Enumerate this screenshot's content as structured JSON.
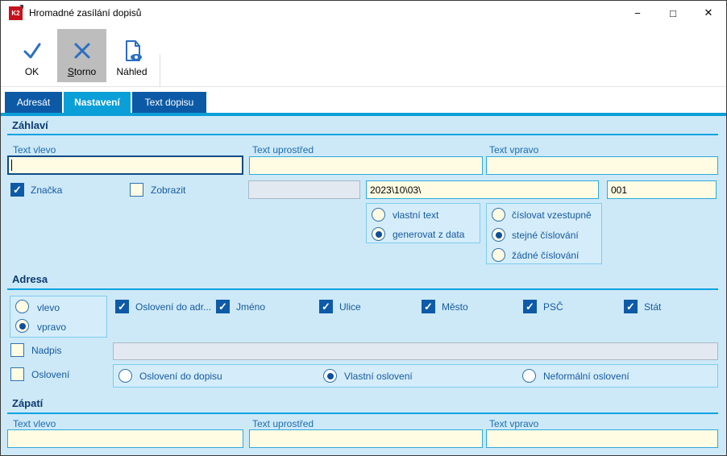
{
  "window": {
    "title": "Hromadné zasílání dopisů",
    "app_icon_text": "K2",
    "controls": {
      "minimize": "−",
      "maximize": "□",
      "close": "✕"
    }
  },
  "toolbar": {
    "buttons": [
      {
        "label": "OK",
        "icon": "ok-check-icon",
        "pressed": false
      },
      {
        "label": "Storno",
        "icon": "cancel-x-icon",
        "pressed": true
      },
      {
        "label": "Náhled",
        "icon": "preview-document-icon",
        "pressed": false
      }
    ]
  },
  "tabs": [
    {
      "label": "Adresát",
      "active": false
    },
    {
      "label": "Nastavení",
      "active": true
    },
    {
      "label": "Text dopisu",
      "active": false
    }
  ],
  "sections": {
    "zahlavi": {
      "title": "Záhlaví",
      "header_fields": [
        {
          "label": "Text vlevo",
          "value": "",
          "focused": true
        },
        {
          "label": "Text uprostřed",
          "value": "",
          "focused": false
        },
        {
          "label": "Text vpravo",
          "value": "",
          "focused": false
        }
      ],
      "znacka": {
        "label": "Značka",
        "checked": true
      },
      "zobrazit": {
        "label": "Zobrazit",
        "checked": false
      },
      "disabled_value": "",
      "date_value": "2023\\10\\03\\",
      "number_value": "001",
      "text_source_group": [
        {
          "label": "vlastní text",
          "selected": false
        },
        {
          "label": "generovat z data",
          "selected": true
        }
      ],
      "numbering_group": [
        {
          "label": "číslovat vzestupně",
          "selected": false
        },
        {
          "label": "stejné číslování",
          "selected": true
        },
        {
          "label": "žádné číslování",
          "selected": false
        }
      ]
    },
    "adresa": {
      "title": "Adresa",
      "position_group": [
        {
          "label": "vlevo",
          "selected": false
        },
        {
          "label": "vpravo",
          "selected": true
        }
      ],
      "checkboxes": [
        {
          "label": "Oslovení do adr...",
          "checked": true
        },
        {
          "label": "Jméno",
          "checked": true
        },
        {
          "label": "Ulice",
          "checked": true
        },
        {
          "label": "Město",
          "checked": true
        },
        {
          "label": "PSČ",
          "checked": true
        },
        {
          "label": "Stát",
          "checked": true
        }
      ],
      "nadpis": {
        "label": "Nadpis",
        "checked": false,
        "value": ""
      },
      "osloveni": {
        "label": "Oslovení",
        "checked": false
      },
      "osloveni_group": [
        {
          "label": "Oslovení do dopisu",
          "selected": false
        },
        {
          "label": "Vlastní oslovení",
          "selected": true
        },
        {
          "label": "Neformální oslovení",
          "selected": false
        }
      ]
    },
    "zapati": {
      "title": "Zápatí",
      "footer_fields": [
        {
          "label": "Text vlevo",
          "value": ""
        },
        {
          "label": "Text uprostřed",
          "value": ""
        },
        {
          "label": "Text vpravo",
          "value": ""
        }
      ]
    }
  },
  "colors": {
    "accent_blue": "#0aa2e0",
    "tab_active": "#0b9fd8",
    "tab_inactive": "#0c5aa6",
    "content_bg": "#cde9f8",
    "field_bg": "#fffce3",
    "checked_blue": "#0e5aa7",
    "toolbar_icon_blue": "#2a6fc4",
    "pressed_gray": "#bdbdbd"
  }
}
